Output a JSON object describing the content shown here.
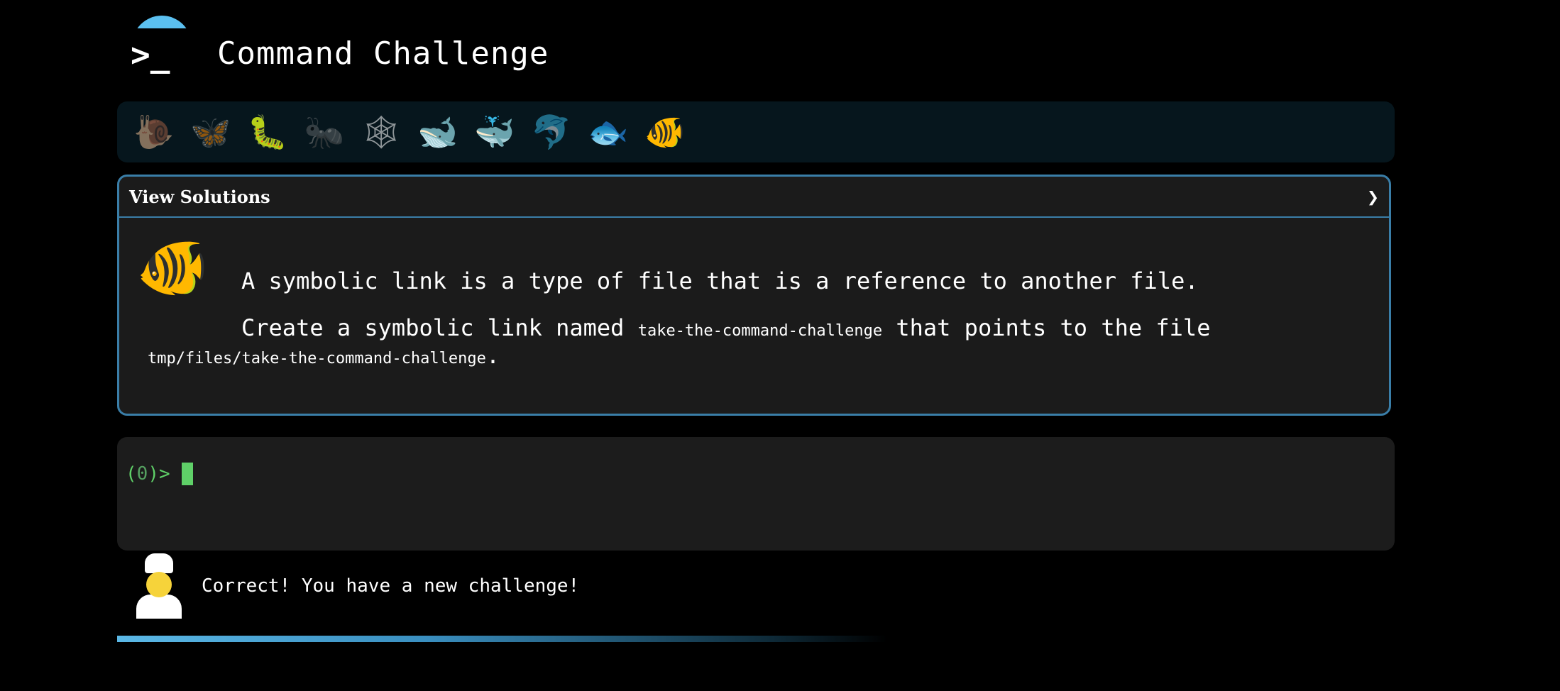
{
  "header": {
    "logo_glyph": ">_",
    "title": "Command Challenge"
  },
  "levels": [
    {
      "name": "snail-icon",
      "glyph": "🐌",
      "state": "dim"
    },
    {
      "name": "butterfly-icon",
      "glyph": "🦋",
      "state": "dim"
    },
    {
      "name": "caterpillar-icon",
      "glyph": "🐛",
      "state": "normal"
    },
    {
      "name": "ant-icon",
      "glyph": "🐜",
      "state": "dim"
    },
    {
      "name": "spider-web-icon",
      "glyph": "🕸",
      "state": "dim"
    },
    {
      "name": "whale-icon",
      "glyph": "🐋",
      "state": "normal"
    },
    {
      "name": "spouting-whale-icon",
      "glyph": "🐳",
      "state": "normal"
    },
    {
      "name": "dolphin-icon",
      "glyph": "🐬",
      "state": "dim"
    },
    {
      "name": "fish-icon",
      "glyph": "🐟",
      "state": "normal"
    },
    {
      "name": "tropical-fish-icon",
      "glyph": "🐠",
      "state": "normal"
    }
  ],
  "solutions_panel": {
    "header_label": "View Solutions",
    "chevron": "❯",
    "challenge_icon": "🐠",
    "description": "A symbolic link is a type of file that is a reference to another file.",
    "task_prefix": "Create a symbolic link named ",
    "task_link_name": "take-the-command-challenge",
    "task_middle": " that points to the file ",
    "task_target": "tmp/files/take-the-command-challenge",
    "task_suffix": "."
  },
  "terminal": {
    "prompt_open": "(",
    "prompt_count": "0",
    "prompt_close": ")>",
    "input_value": ""
  },
  "status": {
    "message": "Correct! You have a new challenge!"
  },
  "progress": {
    "fraction": 0.55
  },
  "colors": {
    "accent": "#5bc0f0",
    "panel_border": "#3a7ea8",
    "terminal_green": "#5fd068"
  }
}
